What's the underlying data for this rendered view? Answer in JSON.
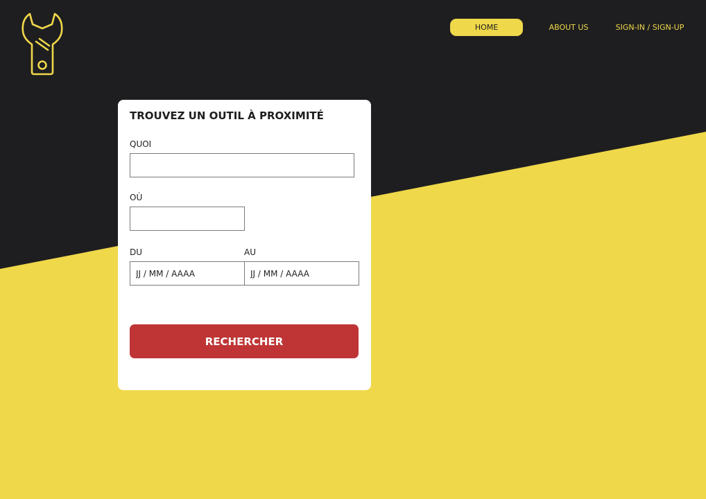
{
  "colors": {
    "dark": "#1e1e20",
    "accent": "#efd84a",
    "button": "#bf3535",
    "card": "#ffffff"
  },
  "logo": {
    "icon": "wrench-icon"
  },
  "nav": {
    "home": "HOME",
    "about": "ABOUT US",
    "sign": "SIGN-IN / SIGN-UP",
    "active": "HOME"
  },
  "search": {
    "title": "TROUVEZ UN OUTIL À PROXIMITÉ",
    "what_label": "QUOI",
    "what_value": "",
    "where_label": "OÙ",
    "where_value": "",
    "from_label": "DU",
    "from_placeholder": "JJ / MM / AAAA",
    "to_label": "AU",
    "to_placeholder": "JJ / MM / AAAA",
    "submit": "RECHERCHER"
  }
}
